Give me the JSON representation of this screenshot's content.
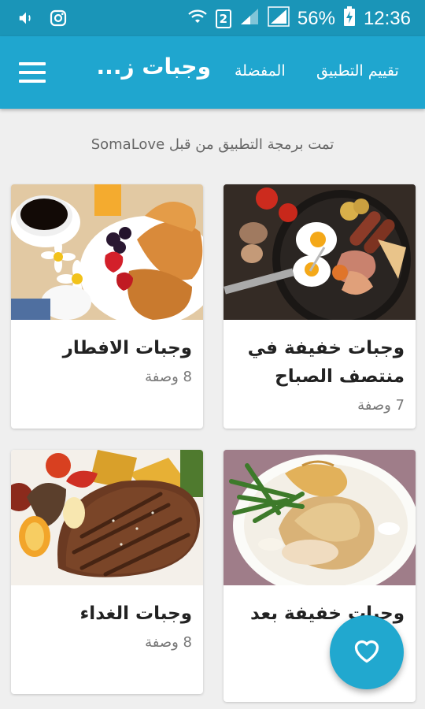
{
  "status_bar": {
    "battery": "56%",
    "time": "12:36",
    "sim_label": "2"
  },
  "app_bar": {
    "title": "وجبات ز...",
    "menu_favorites": "المفضلة",
    "menu_rate": "تقييم التطبيق"
  },
  "credit": "تمت برمجة التطبيق من قبل SomaLove",
  "cards": [
    {
      "title": "وجبات خفيفة في منتصف الصباح",
      "count": "7 وصفة",
      "image": "breakfast-pan-photo"
    },
    {
      "title": "وجبات الافطار",
      "count": "8 وصفة",
      "image": "coffee-croissant-photo"
    },
    {
      "title": "وجبات خفيفة بعد",
      "count": "",
      "image": "chicken-beans-photo"
    },
    {
      "title": "وجبات الغداء",
      "count": "8 وصفة",
      "image": "steak-vegetables-photo"
    }
  ],
  "colors": {
    "status_bar": "#1a95b8",
    "app_bar": "#1fa6cf",
    "fab": "#21a8cf",
    "background": "#efefef"
  },
  "fab": {
    "icon": "heart-icon"
  }
}
